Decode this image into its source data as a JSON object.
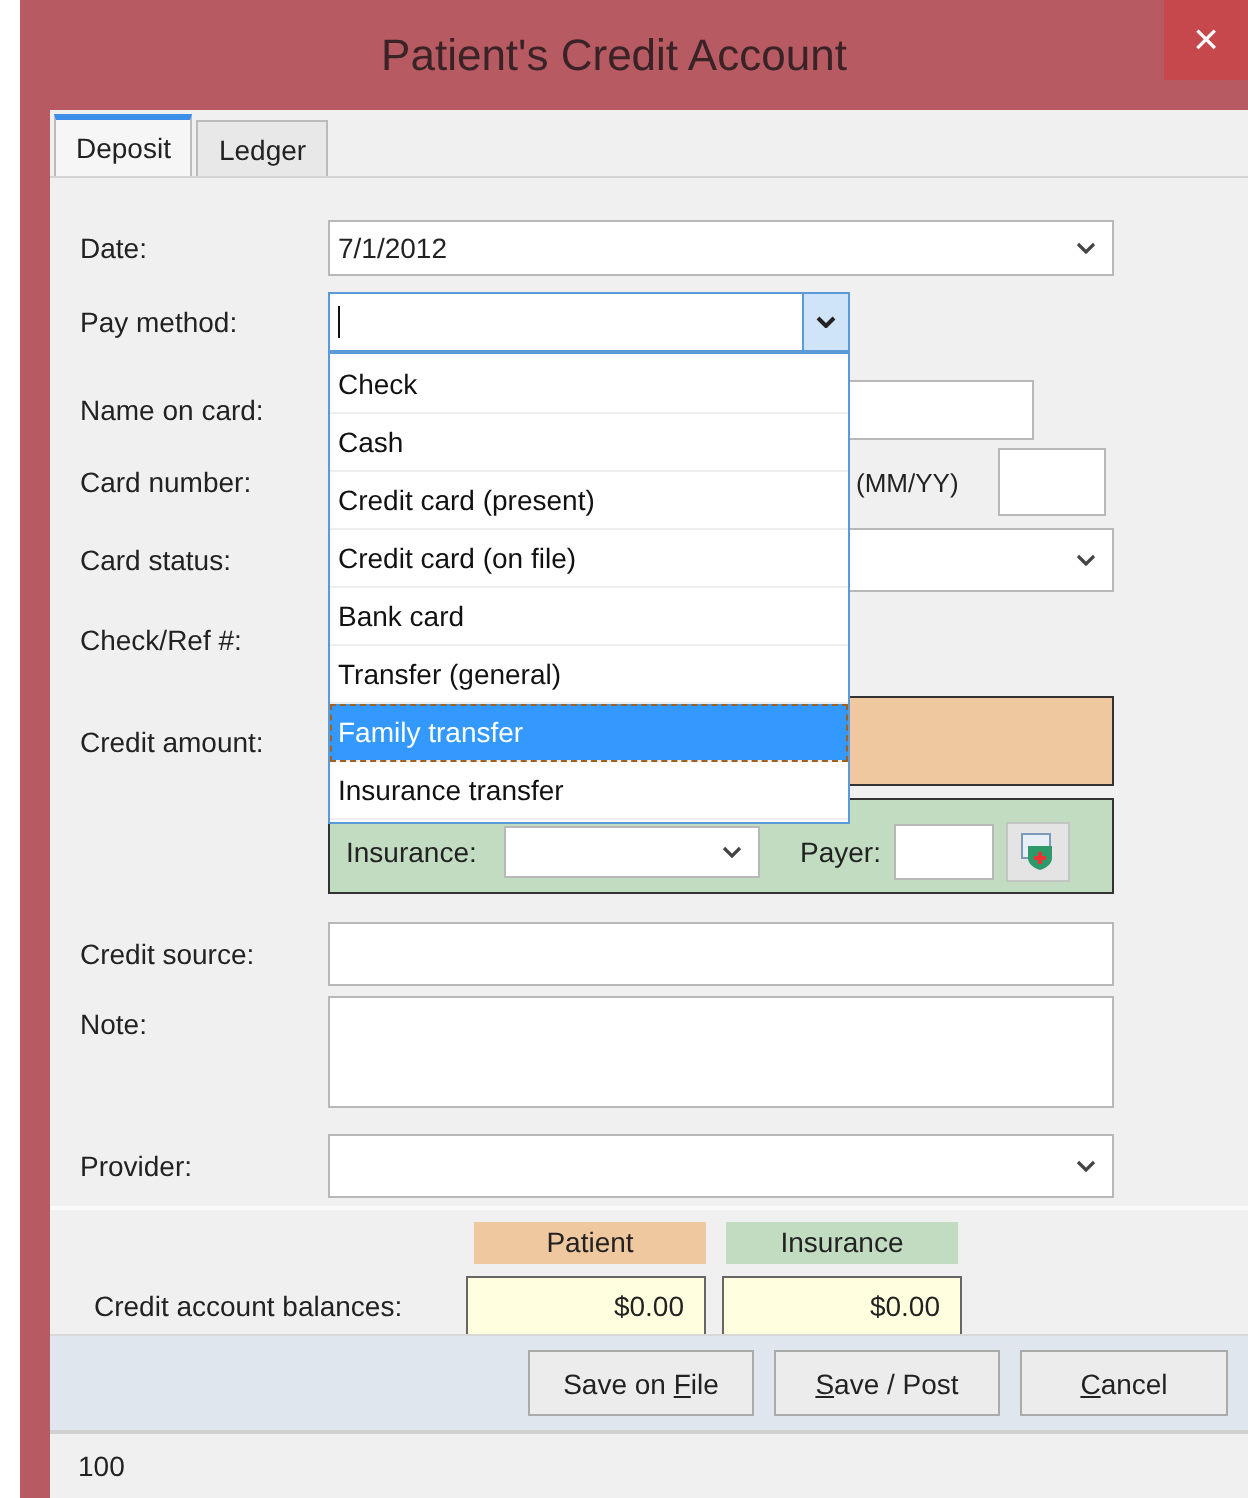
{
  "window": {
    "title": "Patient's Credit Account",
    "close": "×"
  },
  "tabs": [
    {
      "label": "Deposit",
      "selected": true
    },
    {
      "label": "Ledger",
      "selected": false
    }
  ],
  "form": {
    "date": {
      "label": "Date:",
      "value": "7/1/2012"
    },
    "pay_method": {
      "label": "Pay method:",
      "expanded": true,
      "options": [
        {
          "label": "Check",
          "selected": false
        },
        {
          "label": "Cash",
          "selected": false
        },
        {
          "label": "Credit card (present)",
          "selected": false
        },
        {
          "label": "Credit card (on file)",
          "selected": false
        },
        {
          "label": "Bank card",
          "selected": false
        },
        {
          "label": "Transfer (general)",
          "selected": false
        },
        {
          "label": "Family transfer",
          "selected": true
        },
        {
          "label": "Insurance transfer",
          "selected": false
        }
      ]
    },
    "name_on_card": {
      "label": "Name on card:"
    },
    "card_number": {
      "label": "Card number:"
    },
    "expiration": {
      "label": "(MM/YY)"
    },
    "card_status": {
      "label": "Card status:"
    },
    "check_ref": {
      "label": "Check/Ref #:"
    },
    "credit_amount": {
      "label": "Credit amount:"
    },
    "insurance": {
      "label": "Insurance:"
    },
    "payer": {
      "label": "Payer:"
    },
    "credit_source": {
      "label": "Credit source:"
    },
    "note": {
      "label": "Note:"
    },
    "provider": {
      "label": "Provider:"
    }
  },
  "balances": {
    "label": "Credit account balances:",
    "columns": [
      {
        "label": "Patient",
        "value": "$0.00",
        "color": "#f0c8a0"
      },
      {
        "label": "Insurance",
        "value": "$0.00",
        "color": "#c2dcc2"
      }
    ]
  },
  "buttons": [
    {
      "before": "Save on ",
      "key": "F",
      "after": "ile"
    },
    {
      "key": "S",
      "after": "ave / Post"
    },
    {
      "key": "C",
      "after": "ancel"
    }
  ],
  "status_bar": "100"
}
